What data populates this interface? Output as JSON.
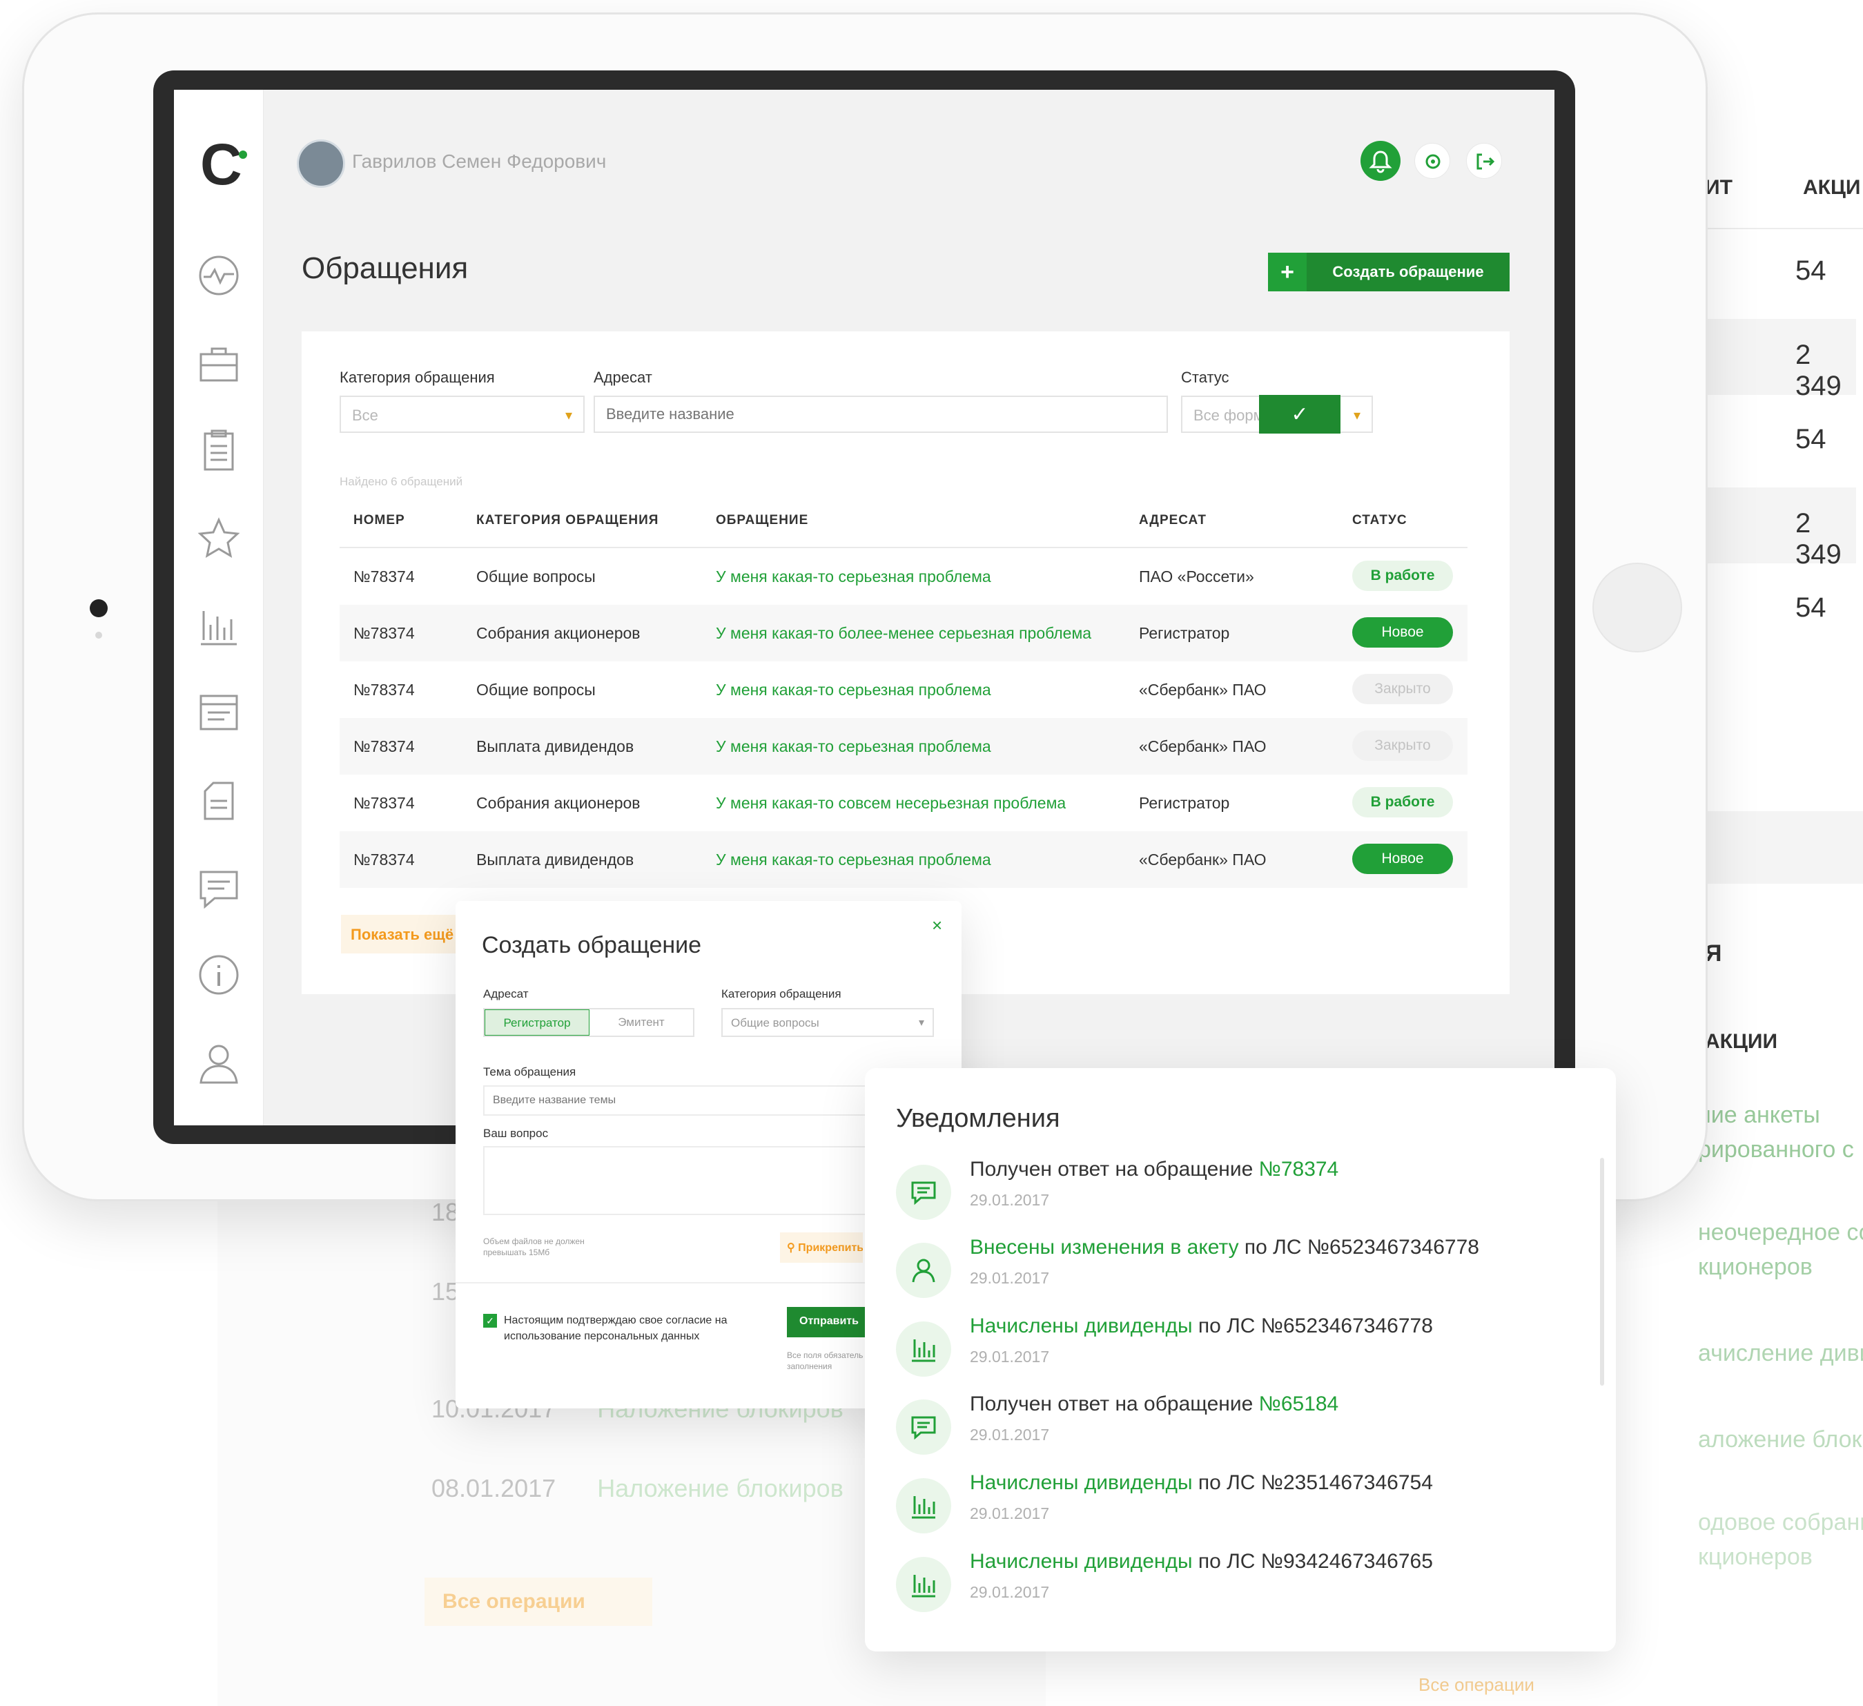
{
  "background": {
    "right_header": {
      "col1": "ИТ",
      "col2": "АКЦИ"
    },
    "right_values": [
      "54",
      "2 349",
      "54",
      "2 349",
      "54"
    ],
    "right_section_header": "Я",
    "right_section_col": "АКЦИИ",
    "right_green_items": [
      "ние анкеты\nрированного с",
      "неочередное собран\nкционеров",
      "ачисление дивиденд",
      "аложение блокиров",
      "одовое собрание\nкционеров"
    ],
    "left_dates": [
      {
        "date": "18",
        "text": ""
      },
      {
        "date": "15",
        "text": ""
      },
      {
        "date": "10.01.2017",
        "text": "Наложение блокиров"
      },
      {
        "date": "08.01.2017",
        "text": "Наложение блокиров"
      }
    ],
    "left_button": "Все операции",
    "bottom_right_button": "Все операции"
  },
  "header": {
    "user_name": "Гаврилов Семен Федорович"
  },
  "page": {
    "title": "Обращения",
    "create_button": "Создать обращение",
    "create_plus": "+"
  },
  "filters": {
    "category_label": "Категория обращения",
    "category_value": "Все",
    "addressee_label": "Адресат",
    "addressee_placeholder": "Введите название",
    "status_label": "Статус",
    "status_value": "Все формы",
    "apply_icon": "✓"
  },
  "table": {
    "found_text": "Найдено 6 обращений",
    "headers": [
      "НОМЕР",
      "КАТЕГОРИЯ ОБРАЩЕНИЯ",
      "ОБРАЩЕНИЕ",
      "АДРЕСАТ",
      "СТАТУС"
    ],
    "rows": [
      {
        "number": "№78374",
        "category": "Общие вопросы",
        "subject": "У меня какая-то серьезная проблема",
        "addressee": "ПАО «Россети»",
        "status": "В работе",
        "status_type": "work"
      },
      {
        "number": "№78374",
        "category": "Собрания акционеров",
        "subject": "У меня какая-то более-менее серьезная проблема",
        "addressee": "Регистратор",
        "status": "Новое",
        "status_type": "new"
      },
      {
        "number": "№78374",
        "category": "Общие вопросы",
        "subject": "У меня какая-то серьезная проблема",
        "addressee": "«Сбербанк» ПАО",
        "status": "Закрыто",
        "status_type": "closed"
      },
      {
        "number": "№78374",
        "category": "Выплата дивидендов",
        "subject": "У меня какая-то серьезная проблема",
        "addressee": "«Сбербанк» ПАО",
        "status": "Закрыто",
        "status_type": "closed"
      },
      {
        "number": "№78374",
        "category": "Собрания акционеров",
        "subject": "У меня какая-то совсем несерьезная проблема",
        "addressee": "Регистратор",
        "status": "В работе",
        "status_type": "work"
      },
      {
        "number": "№78374",
        "category": "Выплата дивидендов",
        "subject": "У меня какая-то серьезная проблема",
        "addressee": "«Сбербанк» ПАО",
        "status": "Новое",
        "status_type": "new"
      }
    ],
    "show_more": "Показать ещё"
  },
  "create_modal": {
    "title": "Создать обращение",
    "close": "×",
    "addressee_label": "Адресат",
    "addressee_options": [
      "Регистратор",
      "Эмитент"
    ],
    "category_label": "Категория обращения",
    "category_value": "Общие вопросы",
    "topic_label": "Тема обращения",
    "topic_placeholder": "Введите название темы",
    "question_label": "Ваш вопрос",
    "file_note": "Объем файлов не должен\nпревышать 15Мб",
    "attach_button": "Прикрепить",
    "consent_text": "Настоящим подтверждаю свое согласие на\nиспользование персональных данных",
    "send_button": "Отправить",
    "required_note": "Все поля обязательны для\nзаполнения"
  },
  "notifications": {
    "title": "Уведомления",
    "items": [
      {
        "icon": "message-icon",
        "pre": "Получен ответ на обращение ",
        "link": "№78374",
        "post": "",
        "link_first": false,
        "date": "29.01.2017"
      },
      {
        "icon": "user-icon",
        "pre": "",
        "link": "Внесены изменения в акету",
        "post": " по ЛС №6523467346778",
        "link_first": true,
        "date": "29.01.2017"
      },
      {
        "icon": "chart-icon",
        "pre": "",
        "link": "Начислены дивиденды",
        "post": " по ЛС №6523467346778",
        "link_first": true,
        "date": "29.01.2017"
      },
      {
        "icon": "message-icon",
        "pre": "Получен ответ на обращение ",
        "link": "№65184",
        "post": "",
        "link_first": false,
        "date": "29.01.2017"
      },
      {
        "icon": "chart-icon",
        "pre": "",
        "link": "Начислены дивиденды",
        "post": " по ЛС №2351467346754",
        "link_first": true,
        "date": "29.01.2017"
      },
      {
        "icon": "chart-icon",
        "pre": "",
        "link": "Начислены дивиденды",
        "post": " по ЛС №9342467346765",
        "link_first": true,
        "date": "29.01.2017"
      }
    ]
  },
  "colors": {
    "accent": "#21a038",
    "dark_accent": "#1f8a30",
    "warning": "#f39a1e"
  }
}
